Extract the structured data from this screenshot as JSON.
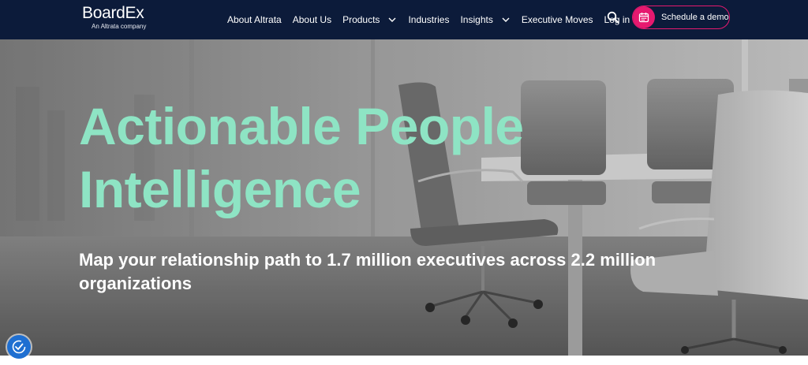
{
  "brand": {
    "name": "BoardEx",
    "tagline": "An Altrata company"
  },
  "nav": {
    "items": [
      {
        "label": "About Altrata",
        "has_dropdown": false
      },
      {
        "label": "About Us",
        "has_dropdown": false
      },
      {
        "label": "Products",
        "has_dropdown": true
      },
      {
        "label": "Industries",
        "has_dropdown": false
      },
      {
        "label": "Insights",
        "has_dropdown": true
      },
      {
        "label": "Executive Moves",
        "has_dropdown": false
      },
      {
        "label": "Log in",
        "has_dropdown": false
      }
    ],
    "search_icon": "search-icon",
    "cta": {
      "label": "Schedule a demo",
      "icon": "calendar-icon"
    }
  },
  "hero": {
    "title_line1": "Actionable People",
    "title_line2": "Intelligence",
    "subtitle_line1": "Map your relationship path to 1.7 million executives across 2.2 million",
    "subtitle_line2": "organizations",
    "background": "office-chairs-photo"
  },
  "privacy_widget": {
    "icon": "consent-check-icon"
  },
  "colors": {
    "nav_bg": "#0c1b3a",
    "accent_pink": "#e6196f",
    "title_mint": "#8ee4c4",
    "privacy_blue": "#1f6fd1"
  }
}
